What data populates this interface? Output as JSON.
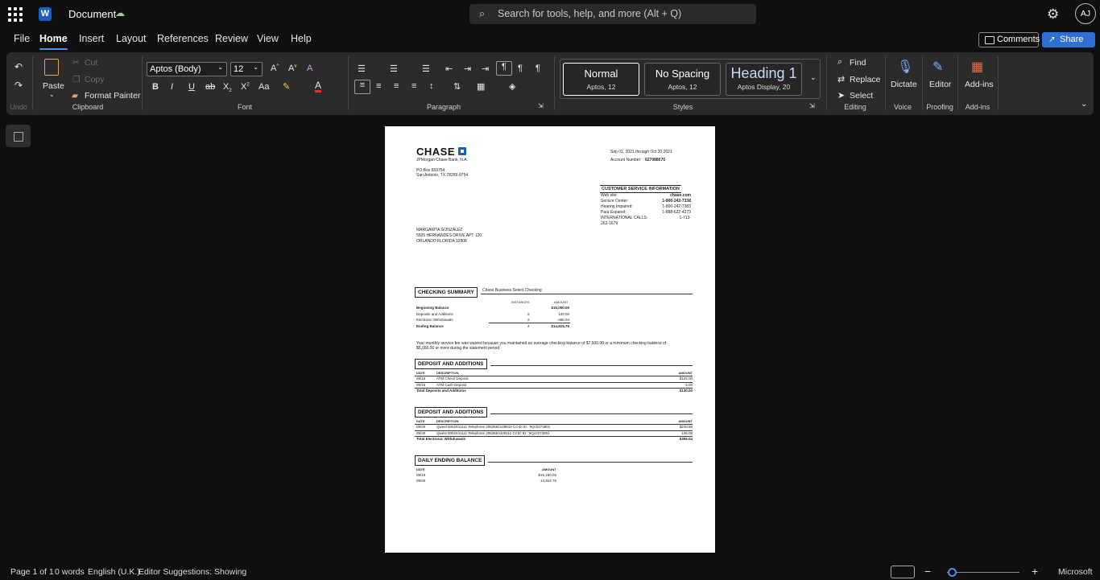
{
  "titlebar": {
    "app_icon": "W",
    "doc_title": "Document",
    "search_placeholder": "Search for tools, help, and more (Alt + Q)",
    "avatar": "AJ"
  },
  "tabs": [
    "File",
    "Home",
    "Insert",
    "Layout",
    "References",
    "Review",
    "View",
    "Help"
  ],
  "actions": {
    "comments": "Comments",
    "share": "Share"
  },
  "ribbon": {
    "undo_label": "Undo",
    "clipboard": {
      "paste": "Paste",
      "cut": "Cut",
      "copy": "Copy",
      "format_painter": "Format Painter",
      "label": "Clipboard"
    },
    "font": {
      "family": "Aptos (Body)",
      "size": "12",
      "label": "Font"
    },
    "paragraph": {
      "label": "Paragraph"
    },
    "styles": {
      "label": "Styles",
      "items": [
        {
          "name": "Normal",
          "sub": "Aptos, 12"
        },
        {
          "name": "No Spacing",
          "sub": "Aptos, 12"
        },
        {
          "name": "Heading 1",
          "sub": "Aptos Display, 20"
        }
      ]
    },
    "editing": {
      "find": "Find",
      "replace": "Replace",
      "select": "Select",
      "label": "Editing"
    },
    "voice": {
      "dictate": "Dictate",
      "label": "Voice"
    },
    "proofing": {
      "editor": "Editor",
      "label": "Proofing"
    },
    "addins": {
      "addins": "Add-ins",
      "label": "Add-ins"
    }
  },
  "document": {
    "brand": "CHASE",
    "bank": "JPMorgan Chase Bank, N.A.",
    "po_box": "PO Box 659754",
    "city": "San Antonio, TX 78265-9754",
    "period": "Sep 01, 2021 through Oct 20,2021",
    "account_label": "Account Number:",
    "account_number": "627088070",
    "csi_title": "CUSTOMER SERVICE INFORMATION",
    "csi": [
      {
        "label": "Web site:",
        "value": "chase.com"
      },
      {
        "label": "Service Center:",
        "value": "1-800-242-7338"
      },
      {
        "label": "Hearing Impaired:",
        "value": "1-800-242-7383"
      },
      {
        "label": "Para Espanol:",
        "value": "1-888-622-4273"
      },
      {
        "label": "INTERNATIONAL CALLS:",
        "value": "1-713-"
      }
    ],
    "csi_wrap": "262-1679",
    "customer": [
      "MARGARITA GONZALEZ",
      "5505 HERNANDES DRIVE APT 120",
      "ORLANDO FLORIDA 32808"
    ],
    "summary_title": "CHECKING SUMMARY",
    "summary_product": "Chase Business Select Checking",
    "summary_headers": {
      "instances": "INSTANCES",
      "amount": "AMOUNT"
    },
    "summary_rows": [
      {
        "label": "Beginning Balance",
        "inst": "",
        "amount": "$15,050.00",
        "bold": true
      },
      {
        "label": "Deposits and Additions",
        "inst": "2",
        "amount": "130.00",
        "bold": false
      },
      {
        "label": "Electronic Withdrawals",
        "inst": "2",
        "amount": "-356.04",
        "bold": false
      },
      {
        "label": "Ending Balance",
        "inst": "4",
        "amount": "$14,824.76",
        "bold": true
      }
    ],
    "fee_note_1": "Your monthly service fee was waived because you maintained an average checking balance of $7,500.00 or a minimum checking balance of",
    "fee_note_2": "$5,000.00 or more during the statement period.",
    "deposits": {
      "title": "DEPOSIT AND ADDITIONS",
      "headers": {
        "date": "DATE",
        "desc": "DESCRIPTION",
        "amount": "AMOUNT"
      },
      "rows": [
        {
          "date": "09/15",
          "desc": "ATM Check Deposit",
          "amount": "$125.00"
        },
        {
          "date": "09/15",
          "desc": "ATM Cash Deposit",
          "amount": "5.00"
        }
      ],
      "total_label": "Total Deposits and Additions",
      "total": "$130.00"
    },
    "withdrawals": {
      "title": "DEPOSIT AND ADDITIONS",
      "headers": {
        "date": "DATE",
        "desc": "DESCRIPTION",
        "amount": "AMOUNT"
      },
      "rows": [
        {
          "date": "09/30",
          "desc": "Qwest 8002441111 Telephone 2063654109818 CCID ID : 9Qc0273801",
          "amount": "$249.96"
        },
        {
          "date": "09/30",
          "desc": "Qwest 8002441111 Telephone 2063654328111 CCID ID : 9Qc0273801",
          "amount": "106.08"
        }
      ],
      "total_label": "Total Electronic Withdrawals",
      "total": "$356.04"
    },
    "daily": {
      "title": "DAILY ENDING BALANCE",
      "headers": {
        "date": "DATE",
        "amount": "AMOUNT"
      },
      "rows": [
        {
          "date": "09/15",
          "amount": "$15,180.00"
        },
        {
          "date": "09/30",
          "amount": "14,824.76"
        }
      ]
    }
  },
  "status": {
    "page": "Page 1 of 1",
    "words": "0 words",
    "language": "English (U.K.)",
    "editor": "Editor Suggestions: Showing",
    "zoom_brand": "Microsoft"
  }
}
